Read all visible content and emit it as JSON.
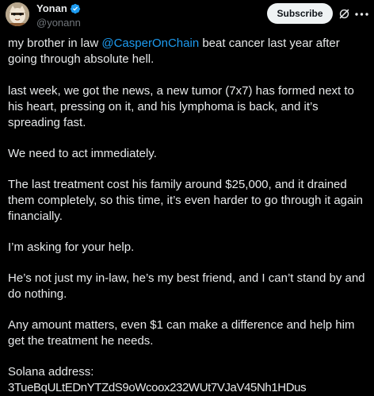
{
  "author": {
    "display_name": "Yonan",
    "handle": "@yonann",
    "avatar_icon": "avatar-image",
    "verified": true
  },
  "actions": {
    "subscribe_label": "Subscribe",
    "grok_icon": "grok-slash-icon",
    "more_icon": "more-dots-icon"
  },
  "colors": {
    "background": "#000000",
    "text": "#e7e9ea",
    "secondary": "#71767b",
    "accent": "#1d9bf0",
    "button_bg": "#eff3f4"
  },
  "post": {
    "p1_before": "my brother in law ",
    "p1_mention": "@CasperOnChain",
    "p1_after": " beat cancer last year after going through absolute hell.",
    "p2": "last week, we got the news, a new tumor (7x7) has formed next to his heart, pressing on it, and his lymphoma is back, and it’s spreading fast.",
    "p3": "We need to act immediately.",
    "p4": "The last treatment cost his family around $25,000, and it drained them completely, so this time, it’s even harder to go through it again financially.",
    "p5": "I’m asking for your help.",
    "p6": "He’s not just my in-law, he’s my best friend, and I can’t stand by and do nothing.",
    "p7": "Any amount matters, even $1 can make a difference and help him get the treatment he needs.",
    "address_label": "Solana address:",
    "address_value": "3TueBqULtEDnYTZdS9oWcoox232WUt7VJaV45Nh1HDus"
  }
}
